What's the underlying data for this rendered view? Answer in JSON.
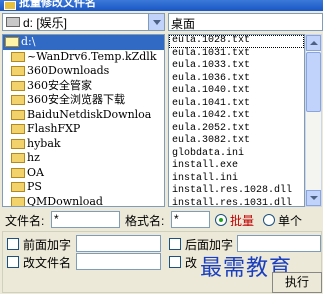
{
  "window": {
    "title": "批量修改文件名"
  },
  "drive": {
    "selected": "d: [娱乐]"
  },
  "path": {
    "current": "桌面"
  },
  "directories": [
    {
      "label": "d:\\",
      "selected": true
    },
    {
      "label": "~WanDrv6.Temp.kZdlk",
      "selected": false
    },
    {
      "label": "360Downloads",
      "selected": false
    },
    {
      "label": "360安全管家",
      "selected": false
    },
    {
      "label": "360安全浏览器下载",
      "selected": false
    },
    {
      "label": "BaiduNetdiskDownloa",
      "selected": false
    },
    {
      "label": "FlashFXP",
      "selected": false
    },
    {
      "label": "hybak",
      "selected": false
    },
    {
      "label": "hz",
      "selected": false
    },
    {
      "label": "OA",
      "selected": false
    },
    {
      "label": "PS",
      "selected": false
    },
    {
      "label": "QMDownload",
      "selected": false
    }
  ],
  "files": [
    "eula.1028.txt",
    "eula.1031.txt",
    "eula.1033.txt",
    "eula.1036.txt",
    "eula.1040.txt",
    "eula.1041.txt",
    "eula.1042.txt",
    "eula.2052.txt",
    "eula.3082.txt",
    "globdata.ini",
    "install.exe",
    "install.ini",
    "install.res.1028.dll",
    "install.res.1031.dll"
  ],
  "filter": {
    "filename_label": "文件名:",
    "filename_value": "*",
    "format_label": "格式名:",
    "format_value": "*",
    "batch_label": "批量",
    "single_label": "单个"
  },
  "options": {
    "prefix_label": "前面加字",
    "suffix_label": "后面加字",
    "rename_label": "改文件名",
    "rename2_label": "改"
  },
  "watermark": "最需教育",
  "exec": {
    "label": "执行"
  },
  "colors": {
    "selection": "#316ac5",
    "batch_text": "#c00000",
    "watermark": "#1a3fbf"
  }
}
